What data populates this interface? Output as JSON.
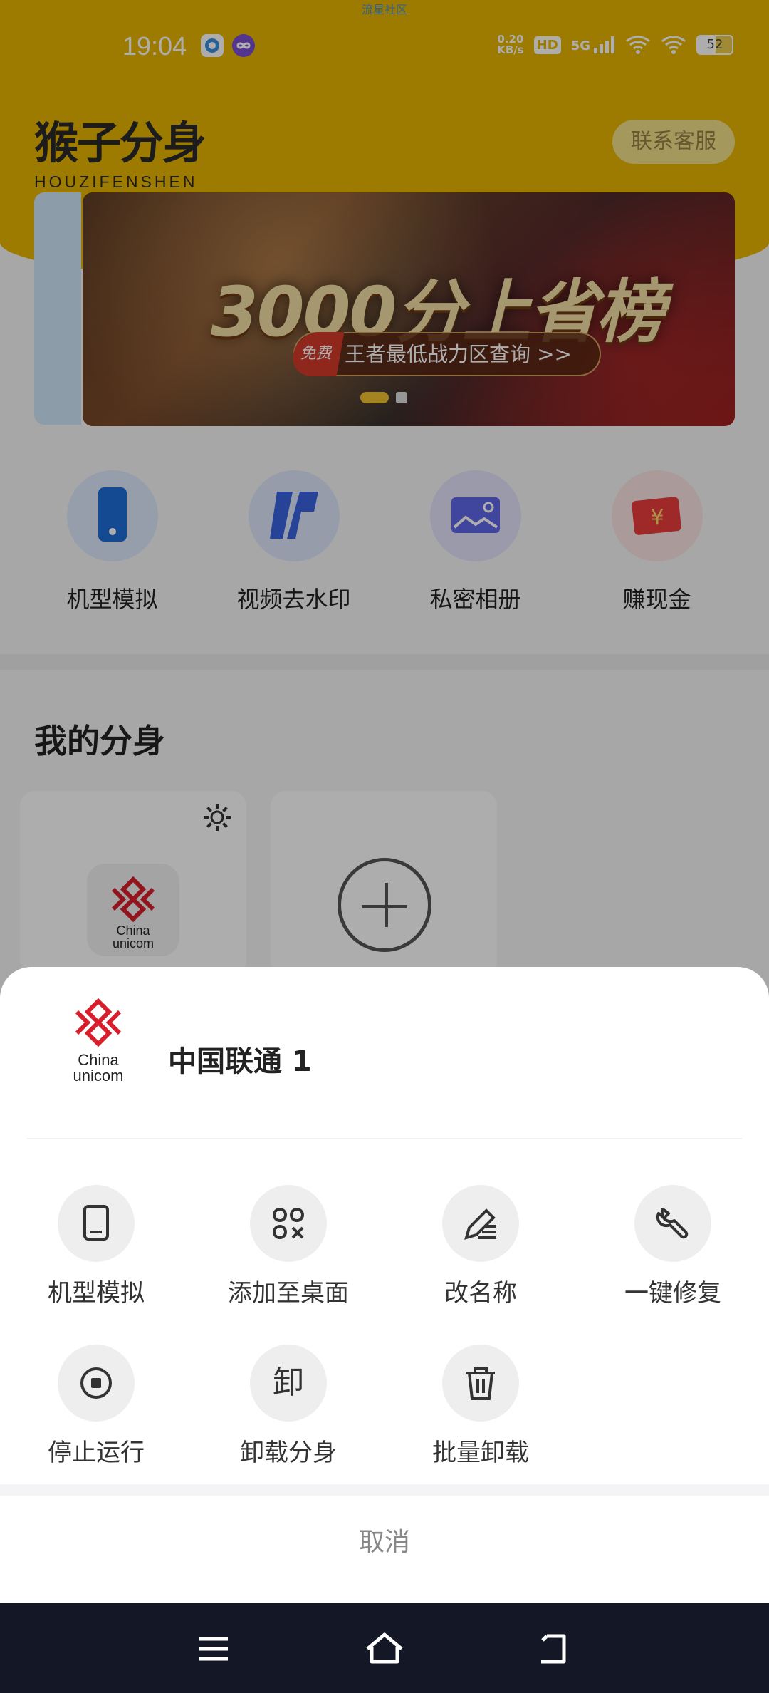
{
  "status_bar": {
    "top_text": "流星社区",
    "time": "19:04",
    "net_speed_value": "0.20",
    "net_speed_unit": "KB/s",
    "hd_label": "HD",
    "signal_label": "5G",
    "battery": "52"
  },
  "header": {
    "logo_cn": "猴子分身",
    "logo_en": "HOUZIFENSHEN",
    "contact_button": "联系客服"
  },
  "banner": {
    "title": "3000分上省榜",
    "free_tag": "免费",
    "subtitle": "王者最低战力区查询 >>",
    "active_index": 0,
    "count": 2
  },
  "features": [
    {
      "label": "机型模拟",
      "icon": "phone-icon"
    },
    {
      "label": "视频去水印",
      "icon": "watermark-icon"
    },
    {
      "label": "私密相册",
      "icon": "album-icon"
    },
    {
      "label": "赚现金",
      "icon": "cash-icon"
    }
  ],
  "my_clones": {
    "title": "我的分身"
  },
  "sheet": {
    "app_name": "中国联通 1",
    "logo_text_line1": "China",
    "logo_text_line2": "unicom",
    "actions": [
      {
        "label": "机型模拟",
        "icon": "tablet-icon"
      },
      {
        "label": "添加至桌面",
        "icon": "add-desktop-icon"
      },
      {
        "label": "改名称",
        "icon": "rename-icon"
      },
      {
        "label": "一键修复",
        "icon": "wrench-icon"
      },
      {
        "label": "停止运行",
        "icon": "stop-icon"
      },
      {
        "label": "卸载分身",
        "icon": "uninstall-icon"
      },
      {
        "label": "批量卸载",
        "icon": "trash-icon"
      }
    ],
    "cancel": "取消"
  },
  "colors": {
    "brand_yellow": "#e6b600",
    "nav_bar": "#141826",
    "unicom_red": "#d81e2a"
  }
}
